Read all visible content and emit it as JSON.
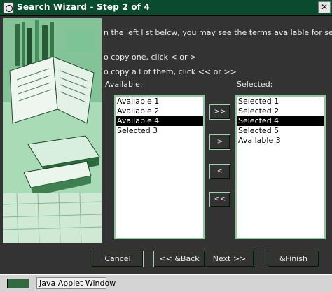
{
  "window": {
    "title": "Search Wizard - Step 2 of 4",
    "close_glyph": "✕"
  },
  "instructions": {
    "line1": "n the left l st belcw, you may see the terms ava lable for sear",
    "line2": "o copy one, click < or >",
    "line3": "o copy a l of them, click << or >>"
  },
  "available": {
    "label": "Available:",
    "items": [
      {
        "text": "Available 1"
      },
      {
        "text": "Available 2"
      },
      {
        "text": "Available 4"
      },
      {
        "text": "Selected 3"
      }
    ]
  },
  "selected": {
    "label": "Selected:",
    "items": [
      {
        "text": "Selected 1"
      },
      {
        "text": "Selected 2"
      },
      {
        "text": "Selected 4"
      },
      {
        "text": "Selected 5"
      },
      {
        "text": "Ava lable 3"
      }
    ]
  },
  "move_buttons": {
    "add_all": ">>",
    "add_one": ">",
    "remove_one": "<",
    "remove_all": "<<"
  },
  "nav_buttons": {
    "cancel": "Cancel",
    "back": "<< &Back",
    "next": "Next >>",
    "finish": "&Finish"
  },
  "statusbar": {
    "icon_text": "",
    "text": "Java Applet Window"
  },
  "colors": {
    "titlebar": "#0a4a2e",
    "background": "#333333",
    "border_accent": "#9fd1aa",
    "selection": "#000000"
  }
}
